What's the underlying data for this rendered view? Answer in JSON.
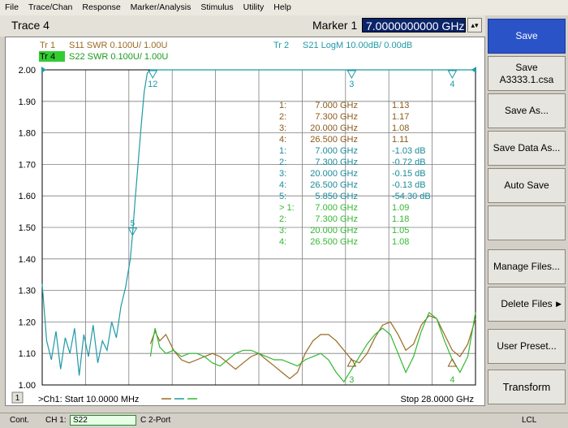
{
  "menu": [
    "File",
    "Trace/Chan",
    "Response",
    "Marker/Analysis",
    "Stimulus",
    "Utility",
    "Help"
  ],
  "title_row": {
    "trace_title": "Trace 4",
    "marker_label": "Marker 1",
    "marker_value": "7.0000000000 GHz"
  },
  "softkeys": [
    {
      "label": "Save",
      "active": true
    },
    {
      "label": "Save",
      "sub": "A3333.1.csa"
    },
    {
      "label": "Save As..."
    },
    {
      "label": "Save Data As..."
    },
    {
      "label": "Auto Save"
    },
    {
      "label": ""
    },
    {
      "label": "Manage Files..."
    },
    {
      "label": "Delete Files",
      "has_arrow": true
    },
    {
      "label": "User Preset..."
    },
    {
      "label": "Transform"
    }
  ],
  "chart": {
    "trace_legend": [
      {
        "tag": "Tr  1",
        "text": "S11 SWR 0.100U/  1.00U",
        "color": "#9a6a22",
        "tag_fill": ""
      },
      {
        "tag": "Tr  4",
        "text": "S22 SWR 0.100U/  1.00U",
        "color": "#1a9a1a",
        "tag_fill": "#33cc33"
      },
      {
        "tag": "Tr  2",
        "text": "S21 LogM 10.00dB/  0.00dB",
        "color": "#1f9aa5",
        "tag_fill": ""
      }
    ],
    "y_tick_labels": [
      "2.00",
      "1.90",
      "1.80",
      "1.70",
      "1.60",
      "1.50",
      "1.40",
      "1.30",
      "1.20",
      "1.10",
      "1.00"
    ],
    "marker_table": [
      {
        "id": "1:",
        "freq": "7.000 GHz",
        "value": "1.13",
        "color": "#8a5a1a"
      },
      {
        "id": "2:",
        "freq": "7.300 GHz",
        "value": "1.17",
        "color": "#8a5a1a"
      },
      {
        "id": "3:",
        "freq": "20.000 GHz",
        "value": "1.08",
        "color": "#8a5a1a"
      },
      {
        "id": "4:",
        "freq": "26.500 GHz",
        "value": "1.11",
        "color": "#8a5a1a"
      },
      {
        "id": "1:",
        "freq": "7.000 GHz",
        "value": "-1.03 dB",
        "color": "#1a8a9a"
      },
      {
        "id": "2:",
        "freq": "7.300 GHz",
        "value": "-0.72 dB",
        "color": "#1a8a9a"
      },
      {
        "id": "3:",
        "freq": "20.000 GHz",
        "value": "-0.15 dB",
        "color": "#1a8a9a"
      },
      {
        "id": "4:",
        "freq": "26.500 GHz",
        "value": "-0.13 dB",
        "color": "#1a8a9a"
      },
      {
        "id": "5:",
        "freq": "5.850 GHz",
        "value": "-54.30 dB",
        "color": "#1a8a9a"
      },
      {
        "id": "> 1:",
        "freq": "7.000 GHz",
        "value": "1.09",
        "color": "#33b833"
      },
      {
        "id": "2:",
        "freq": "7.300 GHz",
        "value": "1.18",
        "color": "#33b833"
      },
      {
        "id": "3:",
        "freq": "20.000 GHz",
        "value": "1.05",
        "color": "#33b833"
      },
      {
        "id": "4:",
        "freq": "26.500 GHz",
        "value": "1.08",
        "color": "#33b833"
      }
    ],
    "marker_flags_top": [
      {
        "label": "12",
        "freq": 7.15
      },
      {
        "label": "3",
        "freq": 20.0
      },
      {
        "label": "4",
        "freq": 26.5
      }
    ],
    "marker_flag_mid": {
      "label": "5",
      "freq": 5.85,
      "swr": 1.48
    },
    "marker_flags_bottom": [
      {
        "label": "3",
        "freq": 20.0
      },
      {
        "label": "4",
        "freq": 26.5
      }
    ],
    "channel_badge": "1",
    "start_text": ">Ch1: Start  10.0000 MHz",
    "stop_text": "Stop  28.0000 GHz"
  },
  "chart_data": {
    "type": "line",
    "title": "",
    "xlabel": "",
    "ylabel": "",
    "xlim": [
      0.01,
      28.0
    ],
    "ylim": [
      1.0,
      2.0
    ],
    "grid": true,
    "y_ticks": [
      2.0,
      1.9,
      1.8,
      1.7,
      1.6,
      1.5,
      1.4,
      1.3,
      1.2,
      1.1,
      1.0
    ],
    "series": [
      {
        "name": "S11 SWR 0.100U/  1.00U",
        "color": "#9a6a22",
        "x": [
          7.0,
          7.15,
          7.3,
          7.6,
          8.0,
          8.5,
          9.0,
          9.5,
          10.0,
          10.5,
          11.0,
          11.5,
          12.0,
          12.5,
          13.0,
          13.5,
          14.0,
          14.5,
          15.0,
          15.5,
          16.0,
          16.5,
          17.0,
          17.5,
          18.0,
          18.5,
          19.0,
          19.5,
          20.0,
          20.5,
          21.0,
          21.5,
          22.0,
          22.5,
          23.0,
          23.5,
          24.0,
          24.5,
          25.0,
          25.5,
          26.0,
          26.5,
          27.0,
          27.5,
          28.0
        ],
        "values": [
          1.13,
          1.15,
          1.17,
          1.14,
          1.16,
          1.11,
          1.08,
          1.07,
          1.08,
          1.09,
          1.1,
          1.09,
          1.07,
          1.05,
          1.07,
          1.09,
          1.1,
          1.08,
          1.06,
          1.04,
          1.02,
          1.04,
          1.1,
          1.14,
          1.16,
          1.16,
          1.14,
          1.11,
          1.08,
          1.07,
          1.1,
          1.15,
          1.19,
          1.2,
          1.16,
          1.11,
          1.13,
          1.19,
          1.22,
          1.21,
          1.16,
          1.11,
          1.09,
          1.13,
          1.21
        ]
      },
      {
        "name": "S22 SWR 0.100U/  1.00U",
        "color": "#33b833",
        "x": [
          7.0,
          7.15,
          7.3,
          7.6,
          8.0,
          8.5,
          9.0,
          9.5,
          10.0,
          10.5,
          11.0,
          11.5,
          12.0,
          12.5,
          13.0,
          13.5,
          14.0,
          14.5,
          15.0,
          15.5,
          16.0,
          16.5,
          17.0,
          17.5,
          18.0,
          18.5,
          19.0,
          19.5,
          20.0,
          20.5,
          21.0,
          21.5,
          22.0,
          22.5,
          23.0,
          23.5,
          24.0,
          24.5,
          25.0,
          25.5,
          26.0,
          26.5,
          27.0,
          27.5,
          28.0
        ],
        "values": [
          1.09,
          1.14,
          1.18,
          1.12,
          1.1,
          1.11,
          1.09,
          1.1,
          1.1,
          1.09,
          1.07,
          1.06,
          1.08,
          1.1,
          1.11,
          1.11,
          1.1,
          1.09,
          1.08,
          1.08,
          1.07,
          1.06,
          1.08,
          1.09,
          1.1,
          1.08,
          1.04,
          1.01,
          1.05,
          1.09,
          1.13,
          1.16,
          1.18,
          1.16,
          1.1,
          1.04,
          1.09,
          1.17,
          1.23,
          1.21,
          1.14,
          1.08,
          1.04,
          1.09,
          1.23
        ]
      },
      {
        "name": "S21 LogM 10.00dB/  0.00dB",
        "color": "#1f9aa5",
        "x": [
          0.01,
          0.3,
          0.6,
          0.9,
          1.2,
          1.5,
          1.8,
          2.1,
          2.4,
          2.7,
          3.0,
          3.3,
          3.6,
          3.9,
          4.2,
          4.5,
          4.8,
          5.1,
          5.4,
          5.7,
          5.85,
          6.0,
          6.2,
          6.4,
          6.6,
          6.8,
          7.0,
          7.3,
          8.0,
          12.0,
          16.0,
          20.0,
          24.0,
          26.5,
          28.0
        ],
        "values": [
          1.32,
          1.14,
          1.08,
          1.17,
          1.05,
          1.15,
          1.1,
          1.18,
          1.03,
          1.16,
          1.09,
          1.19,
          1.07,
          1.14,
          1.11,
          1.2,
          1.15,
          1.25,
          1.31,
          1.4,
          1.48,
          1.58,
          1.7,
          1.82,
          1.93,
          1.99,
          2.0,
          2.0,
          2.0,
          2.0,
          2.0,
          2.0,
          2.0,
          2.0,
          2.0
        ]
      }
    ]
  },
  "status": {
    "mode": "Cont.",
    "channel": "CH 1:",
    "measurement": "S22",
    "cal": "C  2-Port",
    "remote": "LCL"
  }
}
